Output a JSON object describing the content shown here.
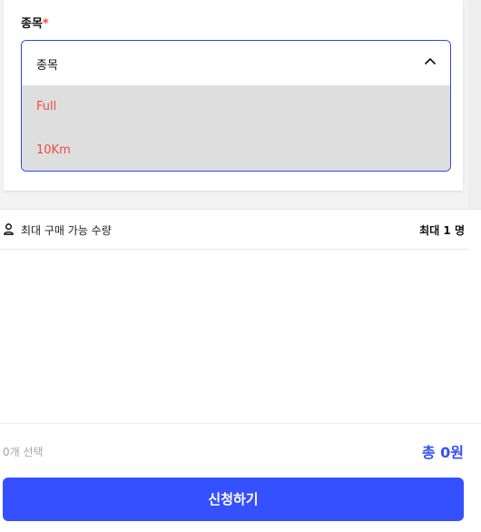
{
  "form": {
    "field_label": "종목",
    "required_mark": "*",
    "dropdown": {
      "selected": "종목",
      "expanded": true,
      "options": [
        "Full",
        "10Km"
      ]
    }
  },
  "info": {
    "icon": "person-icon",
    "label": "최대 구매 가능 수량",
    "value": "최대 1 명"
  },
  "footer": {
    "selected_count": "0개 선택",
    "total": "총 0원",
    "apply_label": "신청하기"
  },
  "colors": {
    "accent": "#3550FF",
    "option_text": "#F24A3D",
    "dropdown_border": "#3147E8"
  }
}
